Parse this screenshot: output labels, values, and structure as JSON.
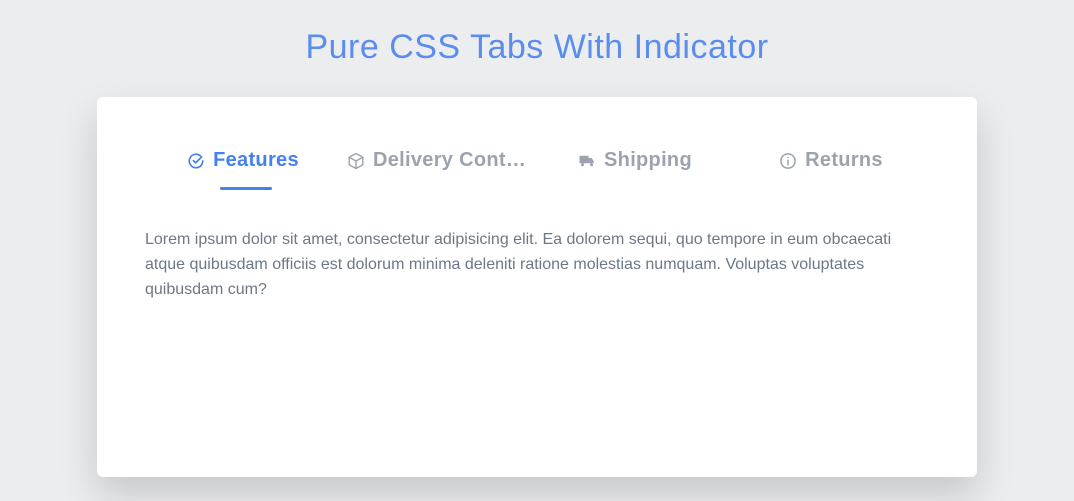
{
  "title": "Pure CSS Tabs With Indicator",
  "tabs": [
    {
      "label": "Features",
      "icon": "check-circle-icon"
    },
    {
      "label": "Delivery Conte...",
      "icon": "box-icon"
    },
    {
      "label": "Shipping",
      "icon": "truck-icon"
    },
    {
      "label": "Returns",
      "icon": "info-icon"
    }
  ],
  "activeIndex": 0,
  "content": {
    "body": "Lorem ipsum dolor sit amet, consectetur adipisicing elit. Ea dolorem sequi, quo tempore in eum obcaecati atque quibusdam officiis est dolorum minima deleniti ratione molestias numquam. Voluptas voluptates quibusdam cum?"
  },
  "colors": {
    "accent": "#4380f0",
    "inactive": "#9aa3ae",
    "bg": "#ecedef"
  }
}
